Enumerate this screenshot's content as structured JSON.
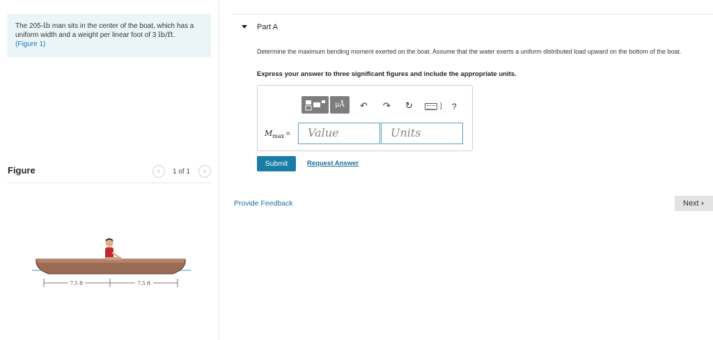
{
  "problem": {
    "text_before": "The 205-",
    "math_unit1": "lb",
    "text_middle": " man sits in the center of the boat, which has a uniform width and a weight per linear foot of 3 ",
    "math_unit2": "lb/ft",
    "text_after": ".",
    "figure_link": "(Figure 1)"
  },
  "figure_panel": {
    "title": "Figure",
    "prev_icon": "‹",
    "next_icon": "›",
    "count": "1 of 1",
    "dim_left": "7.5 ft",
    "dim_right": "7.5 ft"
  },
  "part": {
    "title": "Part A",
    "question": "Determine the maximum bending moment exerted on the boat. Assume that the water exerts a uniform distributed load upward on the bottom of the boat.",
    "instruction": "Express your answer to three significant figures and include the appropriate units."
  },
  "answer": {
    "var_main": "M",
    "var_sub": "max",
    "equals": " =",
    "value_placeholder": "Value",
    "units_placeholder": "Units",
    "units_tool_label": "μÅ",
    "help_label": "?",
    "kb_bracket": "]"
  },
  "actions": {
    "submit": "Submit",
    "request_answer": "Request Answer",
    "feedback": "Provide Feedback",
    "next": "Next"
  },
  "colors": {
    "problem_bg": "#ebf5f7",
    "submit_bg": "#1b7da6",
    "link": "#1b6fa0",
    "boat": "#9a6b55"
  }
}
